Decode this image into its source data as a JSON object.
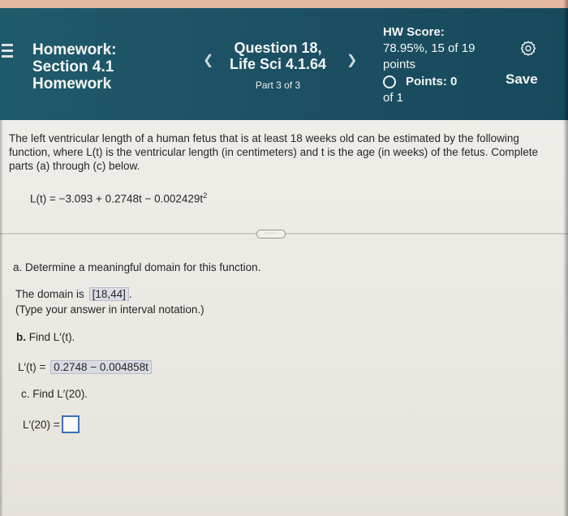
{
  "header": {
    "homework_title": "Homework: Section 4.1 Homework",
    "question_title": "Question 18, Life Sci 4.1.64",
    "question_part": "Part 3 of 3",
    "prev_icon": "chevron-left-icon",
    "next_icon": "chevron-right-icon",
    "hw_score_label": "HW Score:",
    "hw_score_value": "78.95%, 15 of 19 points",
    "points_label": "Points: 0",
    "points_of": "of 1",
    "settings_icon": "gear-icon",
    "save_label": "Save"
  },
  "problem": {
    "prompt": "The left ventricular length of a human fetus that is at least 18 weeks old can be estimated by the following function, where L(t) is the ventricular length (in centimeters) and t is the age (in weeks) of the fetus. Complete parts (a) through (c) below.",
    "equation_main": "L(t) = −3.093 + 0.2748t − 0.002429t",
    "equation_exp": "2",
    "expand_label": "·····"
  },
  "part_a": {
    "question": "a. Determine a meaningful domain for this function.",
    "answer_prefix": "The domain is",
    "answer_value": "[18,44]",
    "answer_suffix": ".",
    "hint": "(Type your answer in interval notation.)"
  },
  "part_b": {
    "question_label": "b.",
    "question_text": "Find L′(t).",
    "answer_prefix": "L′(t) =",
    "answer_value": "0.2748 − 0.004858t"
  },
  "part_c": {
    "question": "c. Find L′(20).",
    "answer_prefix": "L′(20) ="
  }
}
